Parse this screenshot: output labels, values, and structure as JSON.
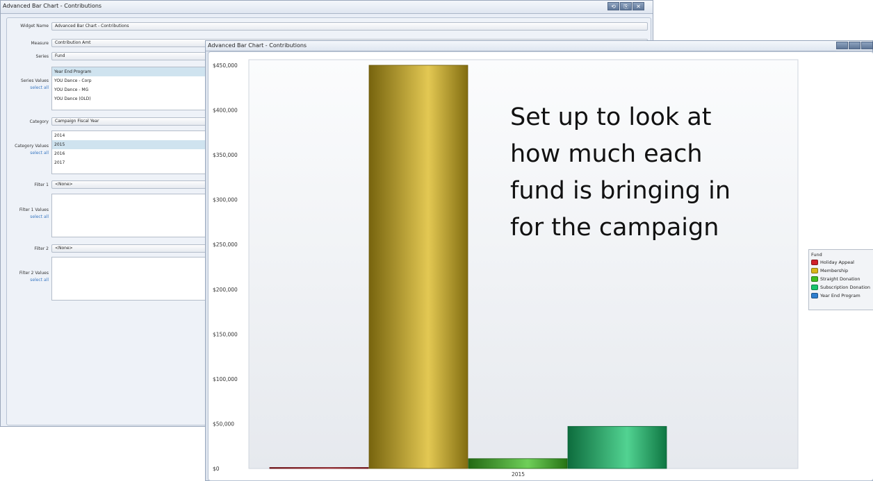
{
  "config_window": {
    "title": "Advanced Bar Chart - Contributions",
    "buttons": [
      "⟲",
      "⎘",
      "✕"
    ],
    "widget_name": {
      "label": "Widget Name",
      "value": "Advanced Bar Chart - Contributions"
    },
    "measure": {
      "label": "Measure",
      "value": "Contribution Amt"
    },
    "series": {
      "label": "Series",
      "value": "Fund"
    },
    "series_values": {
      "label": "Series Values",
      "select_all": "select all",
      "items": [
        "Year End Program",
        "YOU Dance - Corp",
        "YOU Dance - MG",
        "YOU Dance (OLD)"
      ]
    },
    "category": {
      "label": "Category",
      "value": "Campaign Fiscal Year"
    },
    "category_values": {
      "label": "Category Values",
      "select_all": "select all",
      "items": [
        "2014",
        "2015",
        "2016",
        "2017"
      ]
    },
    "filter1": {
      "label": "Filter 1",
      "value": "<None>"
    },
    "filter1_values": {
      "label": "Filter 1 Values",
      "select_all": "select all"
    },
    "filter2": {
      "label": "Filter 2",
      "value": "<None>"
    },
    "filter2_values": {
      "label": "Filter 2 Values",
      "select_all": "select all"
    }
  },
  "chart_window": {
    "title": "Advanced Bar Chart - Contributions"
  },
  "annotation": [
    "Set up to look at",
    "how much each",
    "fund is bringing in",
    "for the campaign"
  ],
  "chart_data": {
    "type": "bar",
    "categories": [
      "2015"
    ],
    "ylim": [
      0,
      450000
    ],
    "ytick_labels": [
      "$0",
      "$50,000",
      "$100,000",
      "$150,000",
      "$200,000",
      "$250,000",
      "$300,000",
      "$350,000",
      "$400,000",
      "$450,000"
    ],
    "legend_title": "Fund",
    "legend_position": "right",
    "series": [
      {
        "name": "Holiday Appeal",
        "values": [
          1000
        ],
        "color": "#d0202a"
      },
      {
        "name": "Membership",
        "values": [
          450000
        ],
        "color": "#d9b61a"
      },
      {
        "name": "Straight Donation",
        "values": [
          11000
        ],
        "color": "#3fbf22"
      },
      {
        "name": "Subscription Donation",
        "values": [
          47000
        ],
        "color": "#18c46e"
      },
      {
        "name": "Year End Program",
        "values": [
          0
        ],
        "color": "#2f7fcf"
      }
    ]
  }
}
